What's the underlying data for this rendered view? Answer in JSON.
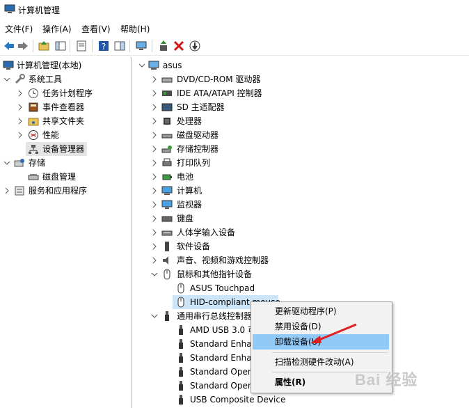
{
  "window": {
    "title": "计算机管理"
  },
  "menu": [
    "文件(F)",
    "操作(A)",
    "查看(V)",
    "帮助(H)"
  ],
  "left_tree": {
    "root": "计算机管理(本地)",
    "items": [
      "系统工具",
      "任务计划程序",
      "事件查看器",
      "共享文件夹",
      "性能",
      "设备管理器",
      "存储",
      "磁盘管理",
      "服务和应用程序"
    ]
  },
  "right_tree": {
    "root": "asus",
    "items": [
      "DVD/CD-ROM 驱动器",
      "IDE ATA/ATAPI 控制器",
      "SD 主适配器",
      "处理器",
      "磁盘驱动器",
      "存储控制器",
      "打印队列",
      "电池",
      "计算机",
      "监视器",
      "键盘",
      "人体学输入设备",
      "软件设备",
      "声音、视频和游戏控制器",
      "鼠标和其他指针设备",
      "ASUS Touchpad",
      "HID-compliant mouse",
      "通用串行总线控制器",
      "AMD USB 3.0 可",
      "Standard Enha",
      "Standard Enha",
      "Standard Oper",
      "Standard Oper",
      "USB Composite Device"
    ]
  },
  "context_menu": {
    "items": [
      "更新驱动程序(P)",
      "禁用设备(D)",
      "卸载设备(U)",
      "扫描检测硬件改动(A)",
      "属性(R)"
    ]
  },
  "watermark": "Bai 经验"
}
